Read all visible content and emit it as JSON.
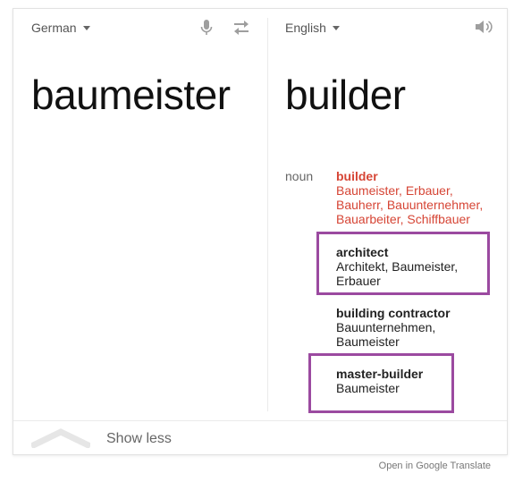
{
  "source": {
    "language": "German",
    "text": "baumeister",
    "mic_icon": "microphone-icon",
    "swap_icon": "swap-arrows-icon"
  },
  "target": {
    "language": "English",
    "text": "builder",
    "speaker_icon": "speaker-icon"
  },
  "dictionary": {
    "part_of_speech": "noun",
    "entries": [
      {
        "term": "builder",
        "synonyms": [
          "Baumeister, Erbauer,",
          "Bauherr, Bauunternehmer,",
          "Bauarbeiter, Schiffbauer"
        ],
        "highlighted": false,
        "emphasis": "red"
      },
      {
        "term": "architect",
        "synonyms": [
          "Architekt, Baumeister,",
          "Erbauer"
        ],
        "highlighted": true
      },
      {
        "term": "building contractor",
        "synonyms": [
          "Bauunternehmen,",
          "Baumeister"
        ],
        "highlighted": false
      },
      {
        "term": "master-builder",
        "synonyms": [
          "Baumeister"
        ],
        "highlighted": true
      }
    ]
  },
  "footer": {
    "show_less_label": "Show less",
    "open_link": "Open in Google Translate"
  },
  "colors": {
    "highlight_box": "#9b4aa0",
    "primary_term": "#d64535"
  }
}
